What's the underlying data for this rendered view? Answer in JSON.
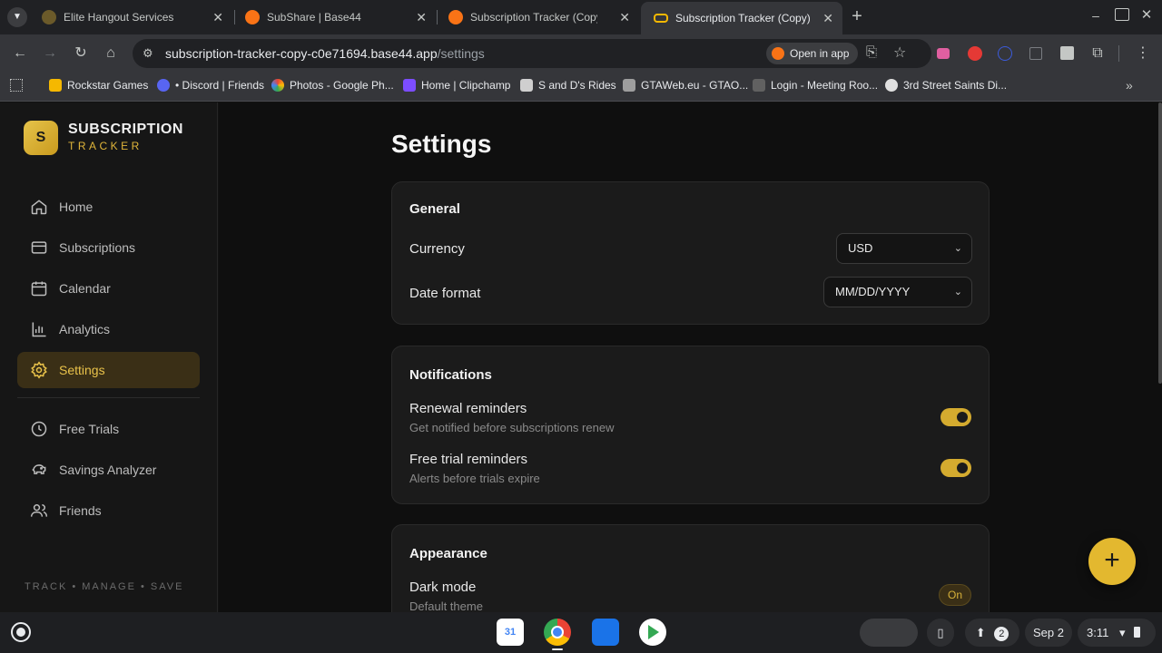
{
  "browser": {
    "tabs": [
      {
        "title": "Elite Hangout Services",
        "favicon_color": "#6b5a2a"
      },
      {
        "title": "SubShare | Base44",
        "favicon_color": "#f97316"
      },
      {
        "title": "Subscription Tracker (Copy) | B",
        "favicon_color": "#f97316"
      },
      {
        "title": "Subscription Tracker (Copy)",
        "favicon_color": "#f5b800"
      }
    ],
    "new_tab_label": "+",
    "url_host": "subscription-tracker-copy-c0e71694.base44.app",
    "url_path": "/settings",
    "open_in_app_label": "Open in app",
    "bookmarks": [
      {
        "label": "Rockstar Games",
        "color": "#f5b800"
      },
      {
        "label": "• Discord | Friends",
        "color": "#5865f2"
      },
      {
        "label": "Photos - Google Ph...",
        "color": "#ea4335"
      },
      {
        "label": "Home | Clipchamp",
        "color": "#7c4dff"
      },
      {
        "label": "S and D's Rides",
        "color": "#cfcfcf"
      },
      {
        "label": "GTAWeb.eu - GTAO...",
        "color": "#9e9e9e"
      },
      {
        "label": "Login - Meeting Roo...",
        "color": "#616161"
      },
      {
        "label": "3rd Street Saints Di...",
        "color": "#e0e0e0"
      }
    ]
  },
  "app": {
    "brand_title": "SUBSCRIPTION",
    "brand_subtitle": "TRACKER",
    "logo_letter": "S",
    "accent_color": "#e3b82f",
    "nav": [
      {
        "label": "Home",
        "icon": "home-icon"
      },
      {
        "label": "Subscriptions",
        "icon": "card-icon"
      },
      {
        "label": "Calendar",
        "icon": "calendar-icon"
      },
      {
        "label": "Analytics",
        "icon": "bar-chart-icon"
      },
      {
        "label": "Settings",
        "icon": "gear-icon",
        "active": true
      }
    ],
    "nav_secondary": [
      {
        "label": "Free Trials",
        "icon": "clock-icon"
      },
      {
        "label": "Savings Analyzer",
        "icon": "piggy-bank-icon"
      },
      {
        "label": "Friends",
        "icon": "users-icon"
      }
    ],
    "tagline": "TRACK • MANAGE • SAVE"
  },
  "settings": {
    "page_title": "Settings",
    "general": {
      "title": "General",
      "currency_label": "Currency",
      "currency_value": "USD",
      "date_format_label": "Date format",
      "date_format_value": "MM/DD/YYYY"
    },
    "notifications": {
      "title": "Notifications",
      "renewal_label": "Renewal reminders",
      "renewal_desc": "Get notified before subscriptions renew",
      "renewal_on": true,
      "trial_label": "Free trial reminders",
      "trial_desc": "Alerts before trials expire",
      "trial_on": true
    },
    "appearance": {
      "title": "Appearance",
      "dark_mode_label": "Dark mode",
      "dark_mode_desc": "Default theme",
      "dark_mode_value": "On"
    },
    "fab_label": "+"
  },
  "shelf": {
    "notification_count": "2",
    "date": "Sep 2",
    "time": "3:11"
  }
}
